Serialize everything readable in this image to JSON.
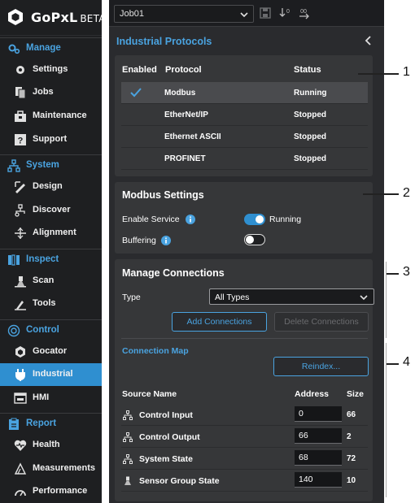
{
  "app": {
    "brand": "GoPxL",
    "brand_suffix": "BETA"
  },
  "sidebar": {
    "sections": [
      {
        "label": "Manage",
        "icon": "gears-icon",
        "items": [
          {
            "label": "Settings",
            "icon": "gear-icon"
          },
          {
            "label": "Jobs",
            "icon": "files-icon"
          },
          {
            "label": "Maintenance",
            "icon": "toolbox-icon"
          },
          {
            "label": "Support",
            "icon": "question-icon"
          }
        ]
      },
      {
        "label": "System",
        "icon": "network-icon",
        "items": [
          {
            "label": "Design",
            "icon": "design-icon"
          },
          {
            "label": "Discover",
            "icon": "discover-icon"
          },
          {
            "label": "Alignment",
            "icon": "alignment-icon"
          }
        ]
      },
      {
        "label": "Inspect",
        "icon": "inspect-icon",
        "items": [
          {
            "label": "Scan",
            "icon": "scan-icon"
          },
          {
            "label": "Tools",
            "icon": "tools-icon"
          }
        ]
      },
      {
        "label": "Control",
        "icon": "control-icon",
        "items": [
          {
            "label": "Gocator",
            "icon": "gocator-icon"
          },
          {
            "label": "Industrial",
            "icon": "industrial-icon",
            "active": true
          },
          {
            "label": "HMI",
            "icon": "hmi-icon"
          }
        ]
      },
      {
        "label": "Report",
        "icon": "report-icon",
        "items": [
          {
            "label": "Health",
            "icon": "health-icon"
          },
          {
            "label": "Measurements",
            "icon": "measurements-icon"
          },
          {
            "label": "Performance",
            "icon": "performance-icon"
          }
        ]
      }
    ]
  },
  "toolbar": {
    "job": "Job01"
  },
  "panel": {
    "title": "Industrial Protocols"
  },
  "protocols": {
    "headers": {
      "enabled": "Enabled",
      "protocol": "Protocol",
      "status": "Status"
    },
    "rows": [
      {
        "name": "Modbus",
        "status": "Running",
        "enabled": true
      },
      {
        "name": "EtherNet/IP",
        "status": "Stopped",
        "enabled": false
      },
      {
        "name": "Ethernet ASCII",
        "status": "Stopped",
        "enabled": false
      },
      {
        "name": "PROFINET",
        "status": "Stopped",
        "enabled": false
      }
    ]
  },
  "modbus": {
    "title": "Modbus Settings",
    "enable_label": "Enable Service",
    "enable_state": "Running",
    "enable_on": true,
    "buffering_label": "Buffering",
    "buffering_on": false
  },
  "connections": {
    "title": "Manage Connections",
    "type_label": "Type",
    "type_value": "All Types",
    "add_label": "Add Connections",
    "delete_label": "Delete Connections",
    "map_title": "Connection Map",
    "reindex_label": "Reindex...",
    "headers": {
      "source": "Source Name",
      "address": "Address",
      "size": "Size"
    },
    "rows": [
      {
        "name": "Control Input",
        "address": "0",
        "size": "66",
        "icon": "network-icon"
      },
      {
        "name": "Control Output",
        "address": "66",
        "size": "2",
        "icon": "network-icon"
      },
      {
        "name": "System State",
        "address": "68",
        "size": "72",
        "icon": "network-icon"
      },
      {
        "name": "Sensor Group State",
        "address": "140",
        "size": "10",
        "icon": "scan-icon"
      }
    ]
  },
  "callouts": [
    "1",
    "2",
    "3",
    "4"
  ]
}
